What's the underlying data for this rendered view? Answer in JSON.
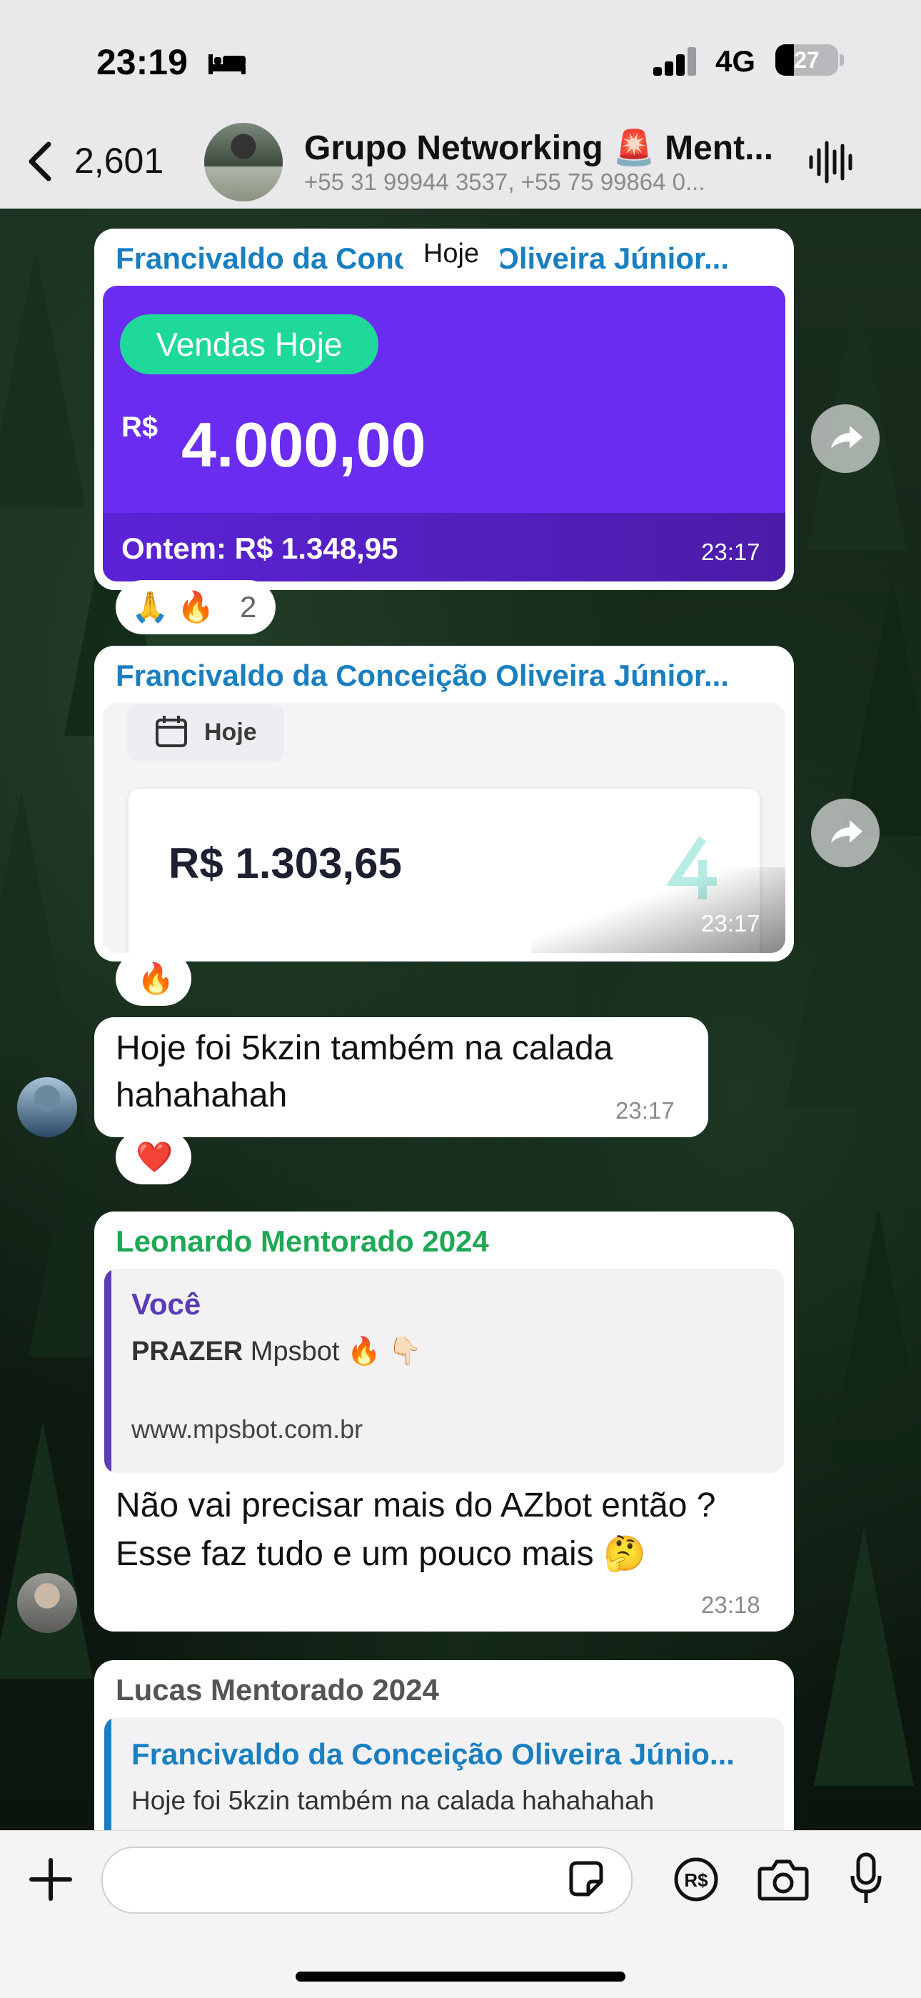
{
  "status_bar": {
    "time": "23:19",
    "network": "4G",
    "battery_level": "27",
    "sleep_icon": "bed-icon"
  },
  "header": {
    "back_count": "2,601",
    "title": "Grupo Networking 🚨 Ment...",
    "subtitle": "+55 31 99944 3537, +55 75 99864 0..."
  },
  "date_chip": "Hoje",
  "messages": [
    {
      "sender": "Francivaldo da Conceição Oliveira Júnior...",
      "image": {
        "badge": "Vendas Hoje",
        "currency": "R$",
        "amount": "4.000,00",
        "footer": "Ontem: R$ 1.348,95"
      },
      "time": "23:17",
      "reactions": {
        "emojis": "🙏 🔥",
        "count": "2"
      }
    },
    {
      "sender": "Francivaldo da Conceição Oliveira Júnior...",
      "image": {
        "tab": "Hoje",
        "amount": "R$ 1.303,65"
      },
      "time": "23:17",
      "reactions": {
        "emojis": "🔥"
      }
    },
    {
      "text_line1": "Hoje foi 5kzin também na calada",
      "text_line2": "hahahahah",
      "time": "23:17",
      "reactions": {
        "emojis": "❤️"
      }
    },
    {
      "sender": "Leonardo Mentorado 2024",
      "quote": {
        "author": "Você",
        "title_bold": "PRAZER",
        "title_rest": " Mpsbot 🔥 👇🏻",
        "link": "www.mpsbot.com.br"
      },
      "text_line1": "Não vai precisar mais do AZbot então ?",
      "text_line2": "Esse faz tudo e um pouco mais 🤔",
      "time": "23:18"
    },
    {
      "sender": "Lucas Mentorado 2024",
      "quote": {
        "author": "Francivaldo da Conceição Oliveira Júnio...",
        "text": "Hoje foi 5kzin também na calada hahahahah"
      }
    }
  ],
  "colors": {
    "sender_blue": "#1a7fc1",
    "sender_green": "#1fa855",
    "sender_gray": "#555555",
    "card_purple": "#6a2cf0",
    "badge_green": "#1ed99a",
    "quote_purple": "#5b3bb6",
    "quote_blue": "#1a7fc1"
  }
}
